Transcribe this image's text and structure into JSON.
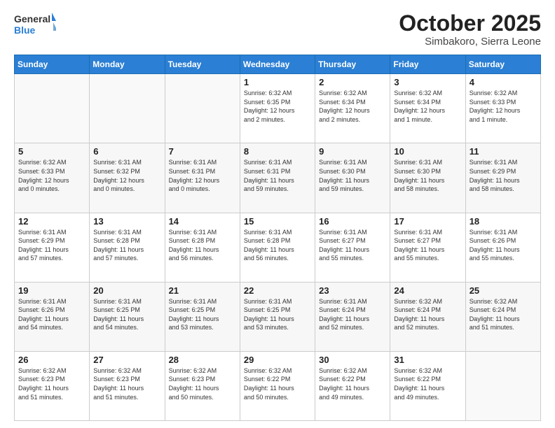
{
  "header": {
    "logo": {
      "line1": "General",
      "line2": "Blue"
    },
    "title": "October 2025",
    "subtitle": "Simbakoro, Sierra Leone"
  },
  "calendar": {
    "headers": [
      "Sunday",
      "Monday",
      "Tuesday",
      "Wednesday",
      "Thursday",
      "Friday",
      "Saturday"
    ],
    "weeks": [
      [
        {
          "day": "",
          "info": ""
        },
        {
          "day": "",
          "info": ""
        },
        {
          "day": "",
          "info": ""
        },
        {
          "day": "1",
          "info": "Sunrise: 6:32 AM\nSunset: 6:35 PM\nDaylight: 12 hours\nand 2 minutes."
        },
        {
          "day": "2",
          "info": "Sunrise: 6:32 AM\nSunset: 6:34 PM\nDaylight: 12 hours\nand 2 minutes."
        },
        {
          "day": "3",
          "info": "Sunrise: 6:32 AM\nSunset: 6:34 PM\nDaylight: 12 hours\nand 1 minute."
        },
        {
          "day": "4",
          "info": "Sunrise: 6:32 AM\nSunset: 6:33 PM\nDaylight: 12 hours\nand 1 minute."
        }
      ],
      [
        {
          "day": "5",
          "info": "Sunrise: 6:32 AM\nSunset: 6:33 PM\nDaylight: 12 hours\nand 0 minutes."
        },
        {
          "day": "6",
          "info": "Sunrise: 6:31 AM\nSunset: 6:32 PM\nDaylight: 12 hours\nand 0 minutes."
        },
        {
          "day": "7",
          "info": "Sunrise: 6:31 AM\nSunset: 6:31 PM\nDaylight: 12 hours\nand 0 minutes."
        },
        {
          "day": "8",
          "info": "Sunrise: 6:31 AM\nSunset: 6:31 PM\nDaylight: 11 hours\nand 59 minutes."
        },
        {
          "day": "9",
          "info": "Sunrise: 6:31 AM\nSunset: 6:30 PM\nDaylight: 11 hours\nand 59 minutes."
        },
        {
          "day": "10",
          "info": "Sunrise: 6:31 AM\nSunset: 6:30 PM\nDaylight: 11 hours\nand 58 minutes."
        },
        {
          "day": "11",
          "info": "Sunrise: 6:31 AM\nSunset: 6:29 PM\nDaylight: 11 hours\nand 58 minutes."
        }
      ],
      [
        {
          "day": "12",
          "info": "Sunrise: 6:31 AM\nSunset: 6:29 PM\nDaylight: 11 hours\nand 57 minutes."
        },
        {
          "day": "13",
          "info": "Sunrise: 6:31 AM\nSunset: 6:28 PM\nDaylight: 11 hours\nand 57 minutes."
        },
        {
          "day": "14",
          "info": "Sunrise: 6:31 AM\nSunset: 6:28 PM\nDaylight: 11 hours\nand 56 minutes."
        },
        {
          "day": "15",
          "info": "Sunrise: 6:31 AM\nSunset: 6:28 PM\nDaylight: 11 hours\nand 56 minutes."
        },
        {
          "day": "16",
          "info": "Sunrise: 6:31 AM\nSunset: 6:27 PM\nDaylight: 11 hours\nand 55 minutes."
        },
        {
          "day": "17",
          "info": "Sunrise: 6:31 AM\nSunset: 6:27 PM\nDaylight: 11 hours\nand 55 minutes."
        },
        {
          "day": "18",
          "info": "Sunrise: 6:31 AM\nSunset: 6:26 PM\nDaylight: 11 hours\nand 55 minutes."
        }
      ],
      [
        {
          "day": "19",
          "info": "Sunrise: 6:31 AM\nSunset: 6:26 PM\nDaylight: 11 hours\nand 54 minutes."
        },
        {
          "day": "20",
          "info": "Sunrise: 6:31 AM\nSunset: 6:25 PM\nDaylight: 11 hours\nand 54 minutes."
        },
        {
          "day": "21",
          "info": "Sunrise: 6:31 AM\nSunset: 6:25 PM\nDaylight: 11 hours\nand 53 minutes."
        },
        {
          "day": "22",
          "info": "Sunrise: 6:31 AM\nSunset: 6:25 PM\nDaylight: 11 hours\nand 53 minutes."
        },
        {
          "day": "23",
          "info": "Sunrise: 6:31 AM\nSunset: 6:24 PM\nDaylight: 11 hours\nand 52 minutes."
        },
        {
          "day": "24",
          "info": "Sunrise: 6:32 AM\nSunset: 6:24 PM\nDaylight: 11 hours\nand 52 minutes."
        },
        {
          "day": "25",
          "info": "Sunrise: 6:32 AM\nSunset: 6:24 PM\nDaylight: 11 hours\nand 51 minutes."
        }
      ],
      [
        {
          "day": "26",
          "info": "Sunrise: 6:32 AM\nSunset: 6:23 PM\nDaylight: 11 hours\nand 51 minutes."
        },
        {
          "day": "27",
          "info": "Sunrise: 6:32 AM\nSunset: 6:23 PM\nDaylight: 11 hours\nand 51 minutes."
        },
        {
          "day": "28",
          "info": "Sunrise: 6:32 AM\nSunset: 6:23 PM\nDaylight: 11 hours\nand 50 minutes."
        },
        {
          "day": "29",
          "info": "Sunrise: 6:32 AM\nSunset: 6:22 PM\nDaylight: 11 hours\nand 50 minutes."
        },
        {
          "day": "30",
          "info": "Sunrise: 6:32 AM\nSunset: 6:22 PM\nDaylight: 11 hours\nand 49 minutes."
        },
        {
          "day": "31",
          "info": "Sunrise: 6:32 AM\nSunset: 6:22 PM\nDaylight: 11 hours\nand 49 minutes."
        },
        {
          "day": "",
          "info": ""
        }
      ]
    ]
  }
}
